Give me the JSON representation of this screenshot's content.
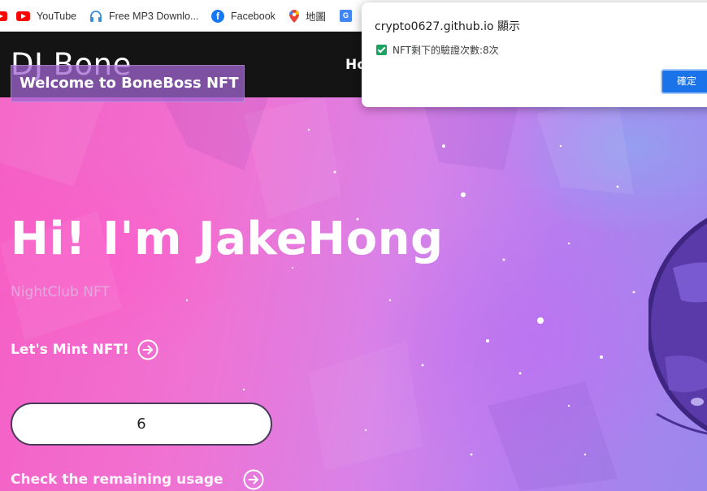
{
  "bookmarks": [
    {
      "label": "",
      "icon": "youtube-partial-icon"
    },
    {
      "label": "YouTube",
      "icon": "youtube-icon"
    },
    {
      "label": "Free MP3 Downlo...",
      "icon": "headphones-icon"
    },
    {
      "label": "Facebook",
      "icon": "facebook-icon"
    },
    {
      "label": "地圖",
      "icon": "maps-pin-icon"
    },
    {
      "label": "",
      "icon": "translate-icon"
    }
  ],
  "header": {
    "logo": "DJ Bone",
    "nav_first": "Ho"
  },
  "hero": {
    "welcome": "Welcome to BoneBoss NFT",
    "title": "Hi! I'm JakeHong",
    "subtitle": "NightClub NFT",
    "mint_label": "Let's Mint NFT!",
    "count_value": "6",
    "check_label": "Check the remaining usage"
  },
  "alert": {
    "title": "crypto0627.github.io 顯示",
    "message": "NFT剩下的驗證次數:8次",
    "ok_label": "確定"
  },
  "colors": {
    "header_bg": "#141414",
    "dialog_button": "#1a73e8",
    "checkbox_green": "#1aa260",
    "hero_pink": "#f55ec4",
    "hero_violet": "#9a88ec"
  }
}
